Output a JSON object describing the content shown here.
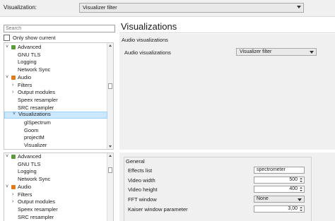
{
  "top": {
    "label": "Visualization:",
    "select_value": "Visualizer filter"
  },
  "search": {
    "placeholder": "Search"
  },
  "filter": {
    "show_current_label": "Only show current"
  },
  "tree1": [
    {
      "label": "Advanced",
      "indent": 0,
      "expander": "v",
      "icon": "#5a9a3a"
    },
    {
      "label": "GNU TLS",
      "indent": 1
    },
    {
      "label": "Logging",
      "indent": 1
    },
    {
      "label": "Network Sync",
      "indent": 1
    },
    {
      "label": "Audio",
      "indent": 0,
      "expander": "v",
      "icon": "#e07a1a"
    },
    {
      "label": "Filters",
      "indent": 1,
      "expander": ">"
    },
    {
      "label": "Output modules",
      "indent": 1,
      "expander": ">"
    },
    {
      "label": "Speex resampler",
      "indent": 1
    },
    {
      "label": "SRC resampler",
      "indent": 1
    },
    {
      "label": "Visualizations",
      "indent": 1,
      "expander": "v",
      "selected": true
    },
    {
      "label": "glSpectrum",
      "indent": 2
    },
    {
      "label": "Goom",
      "indent": 2
    },
    {
      "label": "projectM",
      "indent": 2
    },
    {
      "label": "Visualizer",
      "indent": 2
    }
  ],
  "tree2": [
    {
      "label": "Advanced",
      "indent": 0,
      "expander": "v",
      "icon": "#5a9a3a"
    },
    {
      "label": "GNU TLS",
      "indent": 1
    },
    {
      "label": "Logging",
      "indent": 1
    },
    {
      "label": "Network Sync",
      "indent": 1
    },
    {
      "label": "Audio",
      "indent": 0,
      "expander": "v",
      "icon": "#e07a1a"
    },
    {
      "label": "Filters",
      "indent": 1,
      "expander": ">"
    },
    {
      "label": "Output modules",
      "indent": 1,
      "expander": ">"
    },
    {
      "label": "Speex resampler",
      "indent": 1
    },
    {
      "label": "SRC resampler",
      "indent": 1
    }
  ],
  "page": {
    "title": "Visualizations",
    "section": "Audio visualizations",
    "av_label": "Audio visualizations",
    "av_value": "Visualizer filter"
  },
  "general": {
    "title": "General",
    "fields": [
      {
        "label": "Effects list",
        "value": "spectrometer",
        "kind": "text"
      },
      {
        "label": "Video width",
        "value": "500",
        "kind": "spin"
      },
      {
        "label": "Video height",
        "value": "400",
        "kind": "spin"
      },
      {
        "label": "FFT window",
        "value": "None",
        "kind": "drop"
      },
      {
        "label": "Kaiser window parameter",
        "value": "3,00",
        "kind": "spin"
      }
    ]
  },
  "colors": {
    "selection": "#cce8ff",
    "panel": "#f0f0f0",
    "advanced_icon": "#5a9a3a",
    "audio_icon": "#e07a1a"
  }
}
